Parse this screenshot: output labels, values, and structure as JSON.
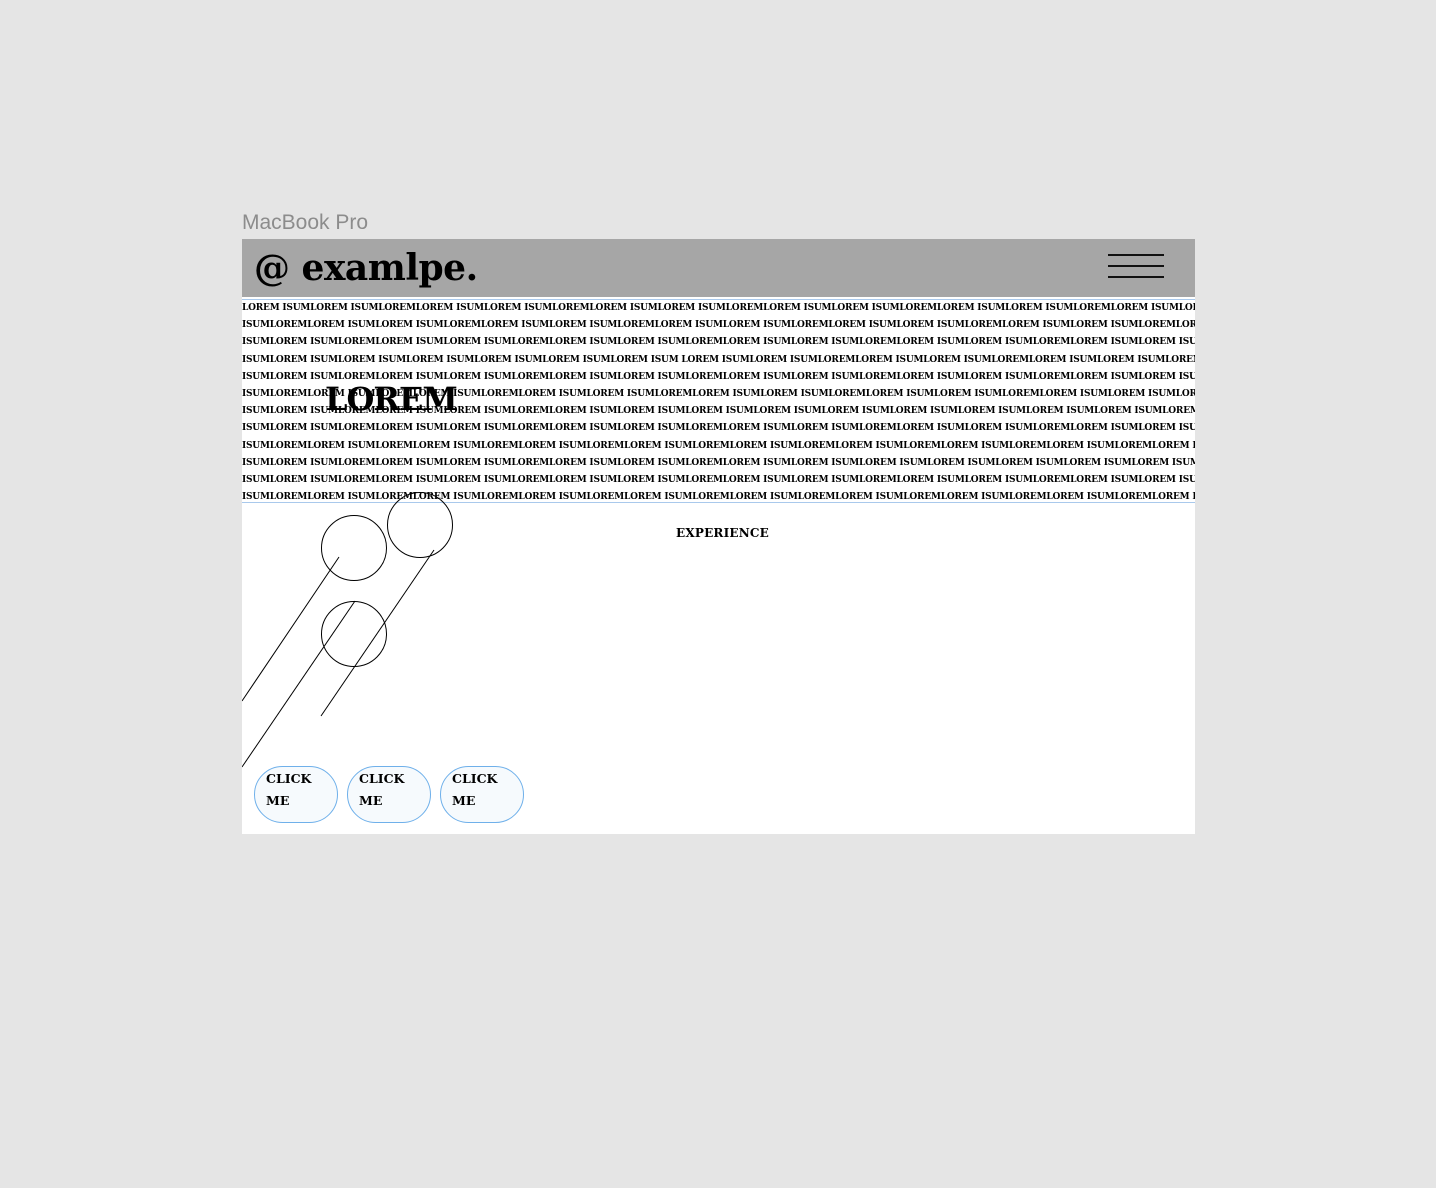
{
  "frame": {
    "label": "MacBook Pro"
  },
  "header": {
    "logo": "@ examlpe.",
    "menu_icon": "hamburger-menu-icon"
  },
  "hero": {
    "pattern_rows": [
      "LOREM ISUMLOREM ISUMLOREMLOREM ISUMLOREM ISUMLOREMLOREM ISUMLOREM ISUMLOREMLOREM ISUMLOREM ISUMLOREMLOREM ISUMLOREM ISUMLOREMLOREM ISUMLOREM ISUMLOREMLOREM ISUMLOREM",
      "ISUMLOREMLOREM ISUMLOREM ISUMLOREMLOREM ISUMLOREM ISUMLOREMLOREM ISUMLOREM ISUMLOREMLOREM ISUMLOREM ISUMLOREMLOREM ISUMLOREM ISUMLOREMLOREM ISUMLOREM ISUMLOREMLOREM",
      "ISUMLOREM ISUMLOREMLOREM ISUMLOREM ISUMLOREMLOREM ISUMLOREM ISUMLOREMLOREM ISUMLOREM ISUMLOREMLOREM ISUMLOREM ISUMLOREMLOREM ISUMLOREM ISUMLOREMLOREM ISUMLOREM ISUMLOREM",
      "ISUMLOREM ISUMLOREM ISUMLOREM ISUMLOREM ISUMLOREM ISUMLOREM ISUM LOREM ISUMLOREM ISUMLOREMLOREM ISUMLOREM ISUMLOREMLOREM ISUMLOREM ISUMLOREMLOREM ISUMLOREM ISUMLOREM",
      "ISUMLOREM ISUMLOREMLOREM ISUMLOREM ISUMLOREMLOREM ISUMLOREM ISUMLOREMLOREM ISUMLOREM ISUMLOREMLOREM ISUMLOREM ISUMLOREMLOREM ISUMLOREM ISUMLOREMLOREM ISUMLOREM ISUMLOREM",
      "ISUMLOREMLOREM ISUMLOREMLOREM ISUMLOREMLOREM ISUMLOREM ISUMLOREMLOREM ISUMLOREM ISUMLOREMLOREM ISUMLOREM ISUMLOREMLOREM ISUMLOREM ISUMLOREMLOREM ISUMLOREM ISUMLOREMLOREM",
      "ISUMLOREM ISUMLOREMLOREM ISUMLOREM ISUMLOREMLOREM ISUMLOREM ISUMLOREM ISUMLOREM ISUMLOREM ISUMLOREM ISUMLOREM ISUMLOREM ISUMLOREM ISUMLOREM ISUM LOREM ISUMLOREM ISUMLOREMLOREM",
      "ISUMLOREM ISUMLOREMLOREM ISUMLOREM ISUMLOREMLOREM ISUMLOREM ISUMLOREMLOREM ISUMLOREM ISUMLOREMLOREM ISUMLOREM ISUMLOREMLOREM ISUMLOREM ISUMLOREMLOREM ISUMLOREM ISUMLOREM",
      "ISUMLOREMLOREM ISUMLOREMLOREM ISUMLOREMLOREM ISUMLOREMLOREM ISUMLOREMLOREM ISUMLOREMLOREM ISUMLOREMLOREM ISUMLOREMLOREM ISUMLOREMLOREM ISUMLOREMLOREM ISUMLOREMLOREM",
      "ISUMLOREM ISUMLOREMLOREM ISUMLOREM ISUMLOREMLOREM ISUMLOREM ISUMLOREMLOREM ISUMLOREM ISUMLOREM ISUMLOREM ISUMLOREM ISUMLOREM ISUMLOREM ISUMLOREM ISUMLOREM ISUMLOREM ISUMLOREM",
      "ISUMLOREM ISUMLOREMLOREM ISUMLOREM ISUMLOREMLOREM ISUMLOREM ISUMLOREMLOREM ISUMLOREM ISUMLOREMLOREM ISUMLOREM ISUMLOREMLOREM ISUMLOREM ISUMLOREMLOREM ISUMLOREM ISUMLOREM",
      "ISUMLOREMLOREM ISUMLOREMLOREM ISUMLOREMLOREM ISUMLOREMLOREM ISUMLOREMLOREM ISUMLOREMLOREM ISUMLOREMLOREM ISUMLOREMLOREM ISUMLOREMLOREM ISUMLOREMLOREM ISUMLOREMLOREM"
    ],
    "heading": "LOREM"
  },
  "section": {
    "experience_label": "EXPERIENCE"
  },
  "buttons": [
    {
      "label": "CLICK ME"
    },
    {
      "label": "CLICK ME"
    },
    {
      "label": "CLICK ME"
    }
  ],
  "colors": {
    "canvas": "#e5e5e5",
    "header_bg": "#a6a6a6",
    "button_border": "#6fb0ea",
    "selection_border": "#a9c9ec"
  }
}
